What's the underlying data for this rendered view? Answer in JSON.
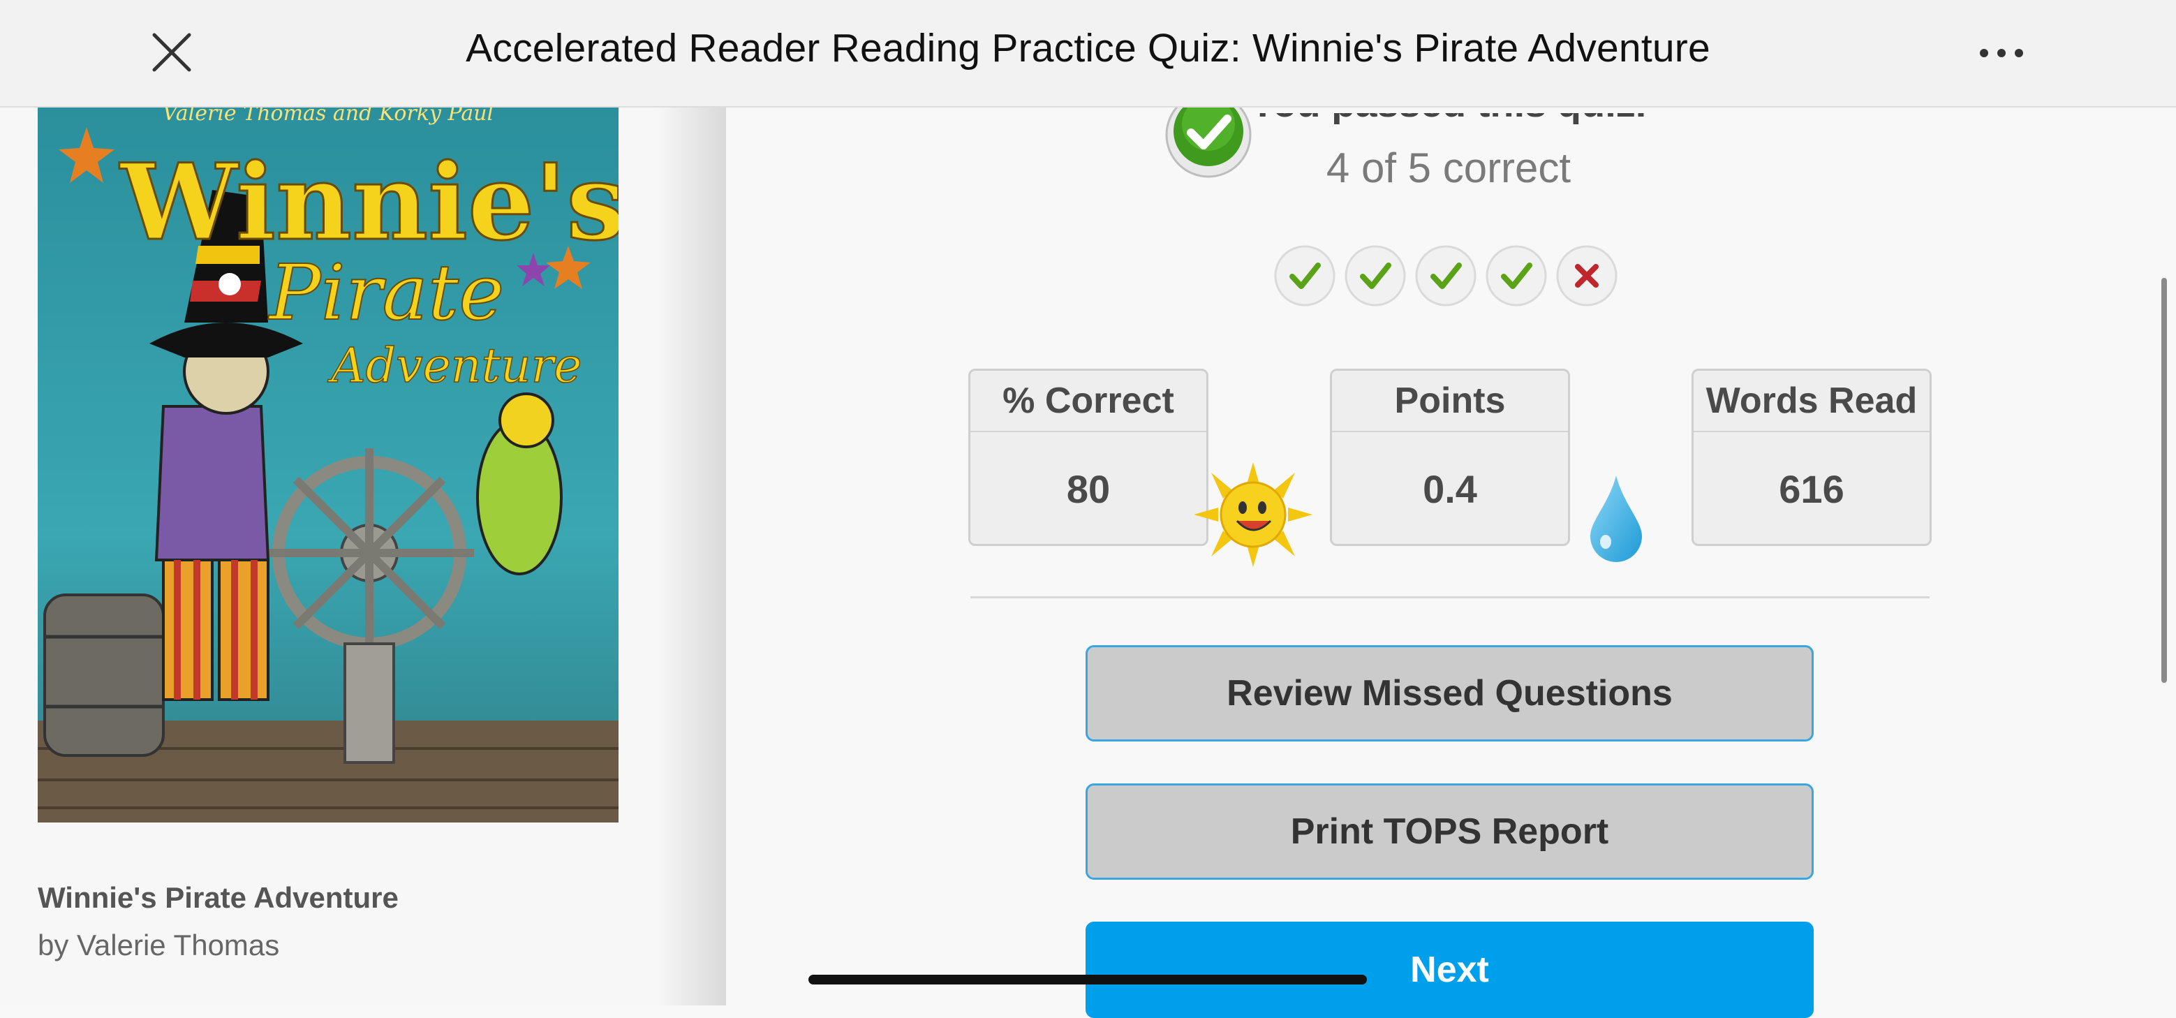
{
  "topbar": {
    "title": "Accelerated Reader Reading Practice Quiz: Winnie's Pirate Adventure",
    "close_icon": "close-icon",
    "more_icon": "more-horizontal-icon"
  },
  "book": {
    "title": "Winnie's Pirate Adventure",
    "author": "by Valerie Thomas",
    "cover": {
      "authors_line": "Valerie Thomas and Korky Paul",
      "title_line1": "Winnie's",
      "title_line2": "Pirate",
      "title_line3": "Adventure"
    }
  },
  "result": {
    "passed_text": "You passed this quiz.",
    "score_text": "4 of 5 correct",
    "questions": [
      {
        "correct": true,
        "icon": "check-icon"
      },
      {
        "correct": true,
        "icon": "check-icon"
      },
      {
        "correct": true,
        "icon": "check-icon"
      },
      {
        "correct": true,
        "icon": "check-icon"
      },
      {
        "correct": false,
        "icon": "x-icon"
      }
    ]
  },
  "stats": {
    "percent_correct": {
      "label": "% Correct",
      "value": "80"
    },
    "points": {
      "label": "Points",
      "value": "0.4"
    },
    "words_read": {
      "label": "Words Read",
      "value": "616"
    }
  },
  "actions": {
    "review_label": "Review Missed Questions",
    "print_label": "Print TOPS Report",
    "next_label": "Next"
  },
  "colors": {
    "accent": "#009fec",
    "correct": "#5aa316",
    "incorrect": "#c0272d"
  }
}
